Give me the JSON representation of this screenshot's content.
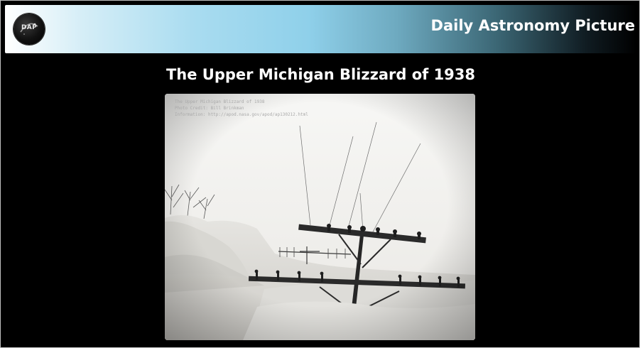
{
  "header": {
    "logo_text": "DAP",
    "site_title": "Daily Astronomy Picture"
  },
  "main": {
    "title": "The Upper Michigan Blizzard of 1938",
    "image": {
      "icon": "photo-of-snow-buried-utility-poles",
      "caption_lines": [
        "The Upper Michigan Blizzard of 1938",
        "Photo Credit: Bill Brinkman",
        "Information: http://apod.nasa.gov/apod/ap130212.html"
      ]
    }
  },
  "colors": {
    "background": "#000000",
    "header_gradient_start": "#ffffff",
    "header_gradient_mid": "#8fd0ea",
    "header_gradient_end": "#000000",
    "title_text": "#ffffff"
  }
}
